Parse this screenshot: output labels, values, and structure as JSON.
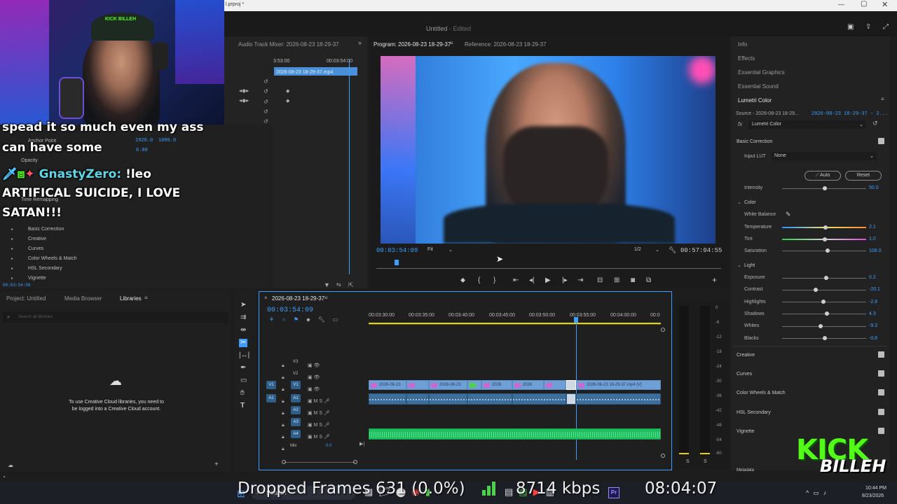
{
  "window": {
    "title": "Untitled",
    "edited": "- Edited",
    "tab": "l.prproj *"
  },
  "audio_mixer": {
    "title": "Audio Track Mixer: 2026-08-23 18-29-37",
    "time_a": "3:53:00",
    "time_b": "00:03:54:00",
    "clip": "2026-08-23 18-29-37.mp4"
  },
  "effect_controls": {
    "anchor_label": "Anchor Point",
    "anchor_x": "1920.0",
    "anchor_y": "1080.0",
    "anti_val": "0.00",
    "opacity": "Opacity",
    "time_remap": "Time Remapping",
    "items": [
      "Basic Correction",
      "Creative",
      "Curves",
      "Color Wheels & Match",
      "HSL Secondary",
      "Vignette"
    ],
    "timecode": "00:03:54:09"
  },
  "program": {
    "title": "Program: 2026-08-23 18-29-37",
    "reference": "Reference: 2026-08-23 18-29-37",
    "timecode": "00:03:54:09",
    "fit": "Fit",
    "resolution": "1/2",
    "duration": "00:57:04:55"
  },
  "right_panel": {
    "tabs": [
      "Info",
      "Effects",
      "Essential Graphics",
      "Essential Sound",
      "Lumetri Color"
    ],
    "source": "Source - 2026-08-23 18-29...",
    "source_seq": "2026-08-23 18-29-37 - 2...",
    "fx_label": "Lumetri Color",
    "basic_correction": "Basic Correction",
    "input_lut": "Input LUT",
    "input_lut_val": "None",
    "auto": "Auto",
    "reset": "Reset",
    "intensity": "Intensity",
    "intensity_val": "50.0",
    "color_section": "Color",
    "white_balance": "White Balance",
    "temperature": "Temperature",
    "temperature_val": "2.1",
    "tint": "Tint",
    "tint_val": "1.0",
    "saturation": "Saturation",
    "saturation_val": "108.0",
    "light_section": "Light",
    "exposure": "Exposure",
    "exposure_val": "0.2",
    "contrast": "Contrast",
    "contrast_val": "-20.1",
    "highlights": "Highlights",
    "highlights_val": "-2.8",
    "shadows": "Shadows",
    "shadows_val": "4.3",
    "whites": "Whites",
    "whites_val": "-9.3",
    "blacks": "Blacks",
    "blacks_val": "-0.8",
    "sections": [
      "Creative",
      "Curves",
      "Color Wheels & Match",
      "HSL Secondary",
      "Vignette"
    ],
    "metadata": "Metadata"
  },
  "project": {
    "tabs": [
      "Project: Untitled",
      "Media Browser",
      "Libraries"
    ],
    "search_placeholder": "Search all libraries",
    "message": "To use Creative Cloud libraries, you need to be logged into a Creative Cloud account."
  },
  "timeline": {
    "title": "2026-08-23 18-29-37",
    "timecode": "00:03:54:09",
    "ruler": [
      "00:03:30:00",
      "00:03:35:00",
      "00:03:40:00",
      "00:03:45:00",
      "00:03:50:00",
      "00:03:55:00",
      "00:04:00:00",
      "00:0"
    ],
    "tracks_video": [
      "V3",
      "V2",
      "V1"
    ],
    "tracks_audio": [
      "A1",
      "A2",
      "A3",
      "A4"
    ],
    "mix": "Mix",
    "mix_val": "0.0",
    "clip_labels": [
      "2026-08-23",
      "2026-08-23",
      "2026",
      "2026",
      "2026-08-23 18-29-37.mp4 [V]"
    ]
  },
  "vu_scale": [
    "0",
    "-6",
    "-12",
    "-18",
    "-24",
    "-30",
    "-36",
    "-42",
    "-48",
    "-54",
    "-60"
  ],
  "vu_solo": [
    "S",
    "S"
  ],
  "overlay": {
    "chat_line1": "spead it so much even my ass",
    "chat_line2": "can have some",
    "chat_user": "GnastyZero:",
    "chat_msg1": "!leo",
    "chat_msg2": "ARTIFICAL SUICIDE, I LOVE",
    "chat_msg3": "SATAN!!!",
    "dropped_frames": "Dropped Frames 631 (0.0%)",
    "bitrate": "8714 kbps",
    "clock": "08:04:07",
    "brand_top": "KICK",
    "brand_bottom": "BILLEH",
    "cap_logo": "KICK BILLEH"
  },
  "taskbar": {
    "search": "Search",
    "time": "10:44 PM",
    "date": "8/23/2026"
  },
  "colors": {
    "accent": "#3d9eff",
    "video_clip": "#6e9fd6",
    "audio_clip": "#3c6e99",
    "green_audio": "#1fbf5f",
    "kick_green": "#53fc18"
  }
}
